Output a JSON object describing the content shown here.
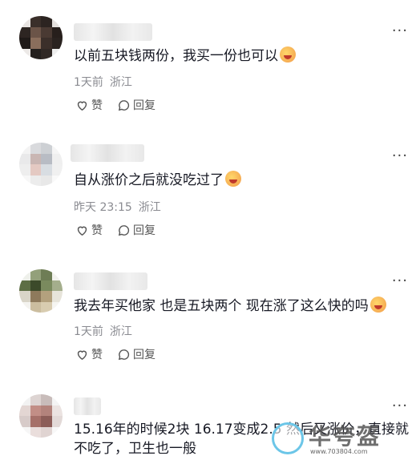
{
  "comments": [
    {
      "text": "以前五块钱两份，我买一份也可以",
      "time": "1天前",
      "location": "浙江",
      "like_label": "赞",
      "reply_label": "回复"
    },
    {
      "text": "自从涨价之后就没吃过了",
      "time": "昨天 23:15",
      "location": "浙江",
      "like_label": "赞",
      "reply_label": "回复"
    },
    {
      "text": "我去年买他家 也是五块两个 现在涨了这么快的吗",
      "time": "1天前",
      "location": "浙江",
      "like_label": "赞",
      "reply_label": "回复"
    },
    {
      "text": "15.16年的时候2块 16.17变成2.5 然后又涨价，直接就不吃了，卫生也一般"
    }
  ],
  "more_label": "···",
  "watermark": {
    "text": "华夸盔",
    "url": "www.703804.com"
  }
}
